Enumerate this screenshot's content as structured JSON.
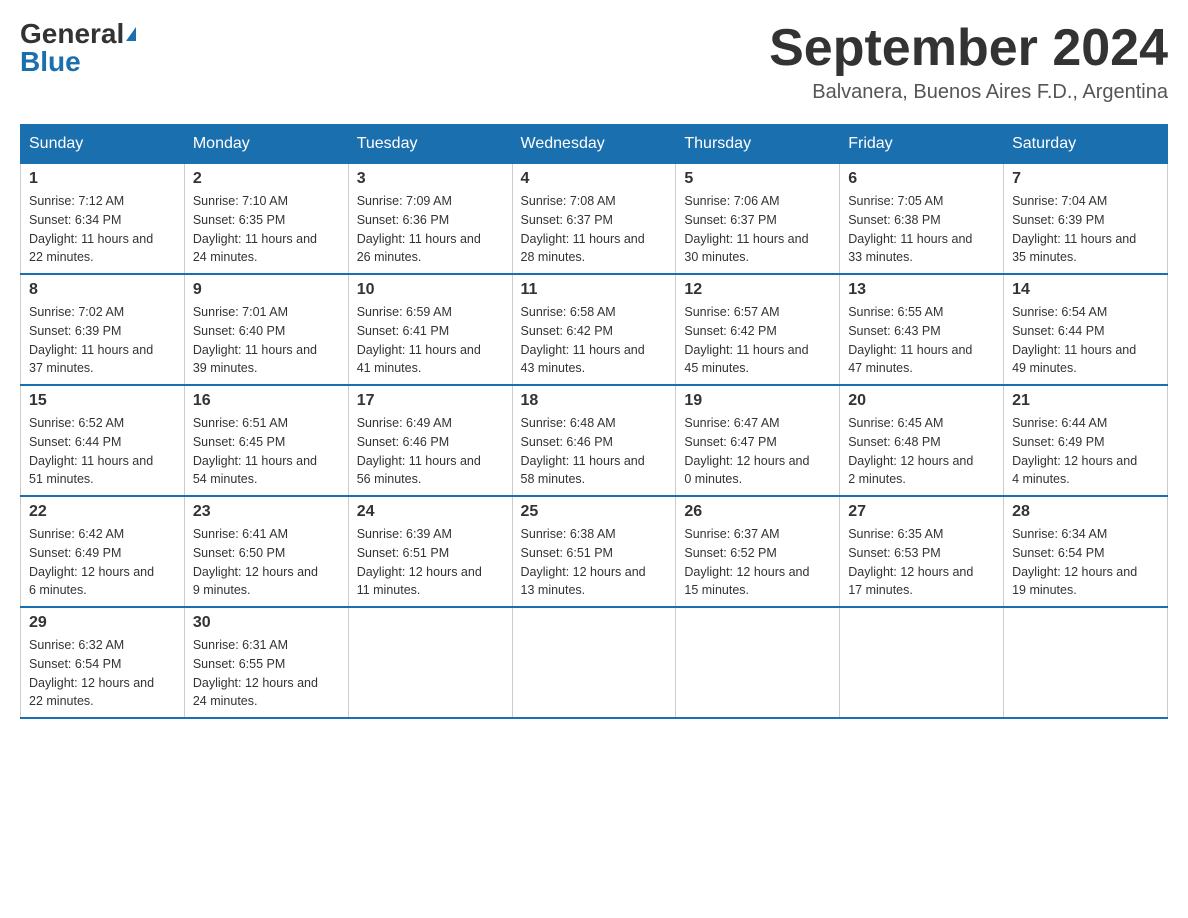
{
  "header": {
    "logo_general": "General",
    "logo_blue": "Blue",
    "title": "September 2024",
    "location": "Balvanera, Buenos Aires F.D., Argentina"
  },
  "days_of_week": [
    "Sunday",
    "Monday",
    "Tuesday",
    "Wednesday",
    "Thursday",
    "Friday",
    "Saturday"
  ],
  "weeks": [
    [
      {
        "day": "1",
        "sunrise": "7:12 AM",
        "sunset": "6:34 PM",
        "daylight": "11 hours and 22 minutes."
      },
      {
        "day": "2",
        "sunrise": "7:10 AM",
        "sunset": "6:35 PM",
        "daylight": "11 hours and 24 minutes."
      },
      {
        "day": "3",
        "sunrise": "7:09 AM",
        "sunset": "6:36 PM",
        "daylight": "11 hours and 26 minutes."
      },
      {
        "day": "4",
        "sunrise": "7:08 AM",
        "sunset": "6:37 PM",
        "daylight": "11 hours and 28 minutes."
      },
      {
        "day": "5",
        "sunrise": "7:06 AM",
        "sunset": "6:37 PM",
        "daylight": "11 hours and 30 minutes."
      },
      {
        "day": "6",
        "sunrise": "7:05 AM",
        "sunset": "6:38 PM",
        "daylight": "11 hours and 33 minutes."
      },
      {
        "day": "7",
        "sunrise": "7:04 AM",
        "sunset": "6:39 PM",
        "daylight": "11 hours and 35 minutes."
      }
    ],
    [
      {
        "day": "8",
        "sunrise": "7:02 AM",
        "sunset": "6:39 PM",
        "daylight": "11 hours and 37 minutes."
      },
      {
        "day": "9",
        "sunrise": "7:01 AM",
        "sunset": "6:40 PM",
        "daylight": "11 hours and 39 minutes."
      },
      {
        "day": "10",
        "sunrise": "6:59 AM",
        "sunset": "6:41 PM",
        "daylight": "11 hours and 41 minutes."
      },
      {
        "day": "11",
        "sunrise": "6:58 AM",
        "sunset": "6:42 PM",
        "daylight": "11 hours and 43 minutes."
      },
      {
        "day": "12",
        "sunrise": "6:57 AM",
        "sunset": "6:42 PM",
        "daylight": "11 hours and 45 minutes."
      },
      {
        "day": "13",
        "sunrise": "6:55 AM",
        "sunset": "6:43 PM",
        "daylight": "11 hours and 47 minutes."
      },
      {
        "day": "14",
        "sunrise": "6:54 AM",
        "sunset": "6:44 PM",
        "daylight": "11 hours and 49 minutes."
      }
    ],
    [
      {
        "day": "15",
        "sunrise": "6:52 AM",
        "sunset": "6:44 PM",
        "daylight": "11 hours and 51 minutes."
      },
      {
        "day": "16",
        "sunrise": "6:51 AM",
        "sunset": "6:45 PM",
        "daylight": "11 hours and 54 minutes."
      },
      {
        "day": "17",
        "sunrise": "6:49 AM",
        "sunset": "6:46 PM",
        "daylight": "11 hours and 56 minutes."
      },
      {
        "day": "18",
        "sunrise": "6:48 AM",
        "sunset": "6:46 PM",
        "daylight": "11 hours and 58 minutes."
      },
      {
        "day": "19",
        "sunrise": "6:47 AM",
        "sunset": "6:47 PM",
        "daylight": "12 hours and 0 minutes."
      },
      {
        "day": "20",
        "sunrise": "6:45 AM",
        "sunset": "6:48 PM",
        "daylight": "12 hours and 2 minutes."
      },
      {
        "day": "21",
        "sunrise": "6:44 AM",
        "sunset": "6:49 PM",
        "daylight": "12 hours and 4 minutes."
      }
    ],
    [
      {
        "day": "22",
        "sunrise": "6:42 AM",
        "sunset": "6:49 PM",
        "daylight": "12 hours and 6 minutes."
      },
      {
        "day": "23",
        "sunrise": "6:41 AM",
        "sunset": "6:50 PM",
        "daylight": "12 hours and 9 minutes."
      },
      {
        "day": "24",
        "sunrise": "6:39 AM",
        "sunset": "6:51 PM",
        "daylight": "12 hours and 11 minutes."
      },
      {
        "day": "25",
        "sunrise": "6:38 AM",
        "sunset": "6:51 PM",
        "daylight": "12 hours and 13 minutes."
      },
      {
        "day": "26",
        "sunrise": "6:37 AM",
        "sunset": "6:52 PM",
        "daylight": "12 hours and 15 minutes."
      },
      {
        "day": "27",
        "sunrise": "6:35 AM",
        "sunset": "6:53 PM",
        "daylight": "12 hours and 17 minutes."
      },
      {
        "day": "28",
        "sunrise": "6:34 AM",
        "sunset": "6:54 PM",
        "daylight": "12 hours and 19 minutes."
      }
    ],
    [
      {
        "day": "29",
        "sunrise": "6:32 AM",
        "sunset": "6:54 PM",
        "daylight": "12 hours and 22 minutes."
      },
      {
        "day": "30",
        "sunrise": "6:31 AM",
        "sunset": "6:55 PM",
        "daylight": "12 hours and 24 minutes."
      },
      null,
      null,
      null,
      null,
      null
    ]
  ]
}
